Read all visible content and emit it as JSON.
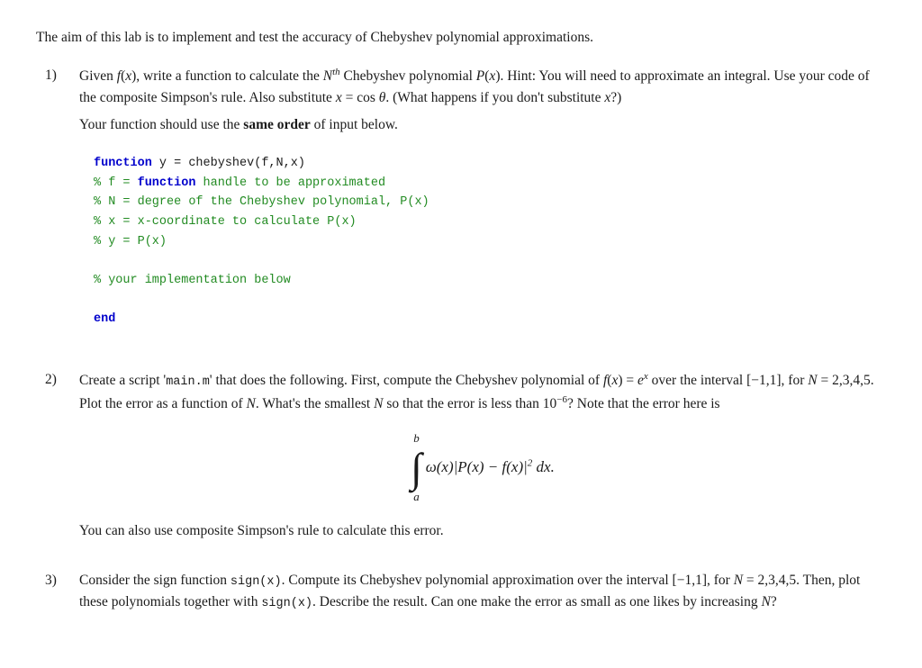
{
  "intro": "The aim of this lab is to implement and test the accuracy of Chebyshev polynomial approximations.",
  "questions": [
    {
      "number": "1)",
      "paragraphs": [
        "Given f(x), write a function to calculate the Nth Chebyshev polynomial P(x). Hint: You will need to approximate an integral. Use your code of the composite Simpson's rule. Also substitute x = cos θ. (What happens if you don't substitute x?)",
        "Your function should use the same order of input below."
      ],
      "code_lines": [
        {
          "parts": [
            {
              "text": "function",
              "style": "blue"
            },
            {
              "text": " y = chebyshev(f,N,x)",
              "style": "black"
            }
          ]
        },
        {
          "parts": [
            {
              "text": "% f = ",
              "style": "green"
            },
            {
              "text": "function",
              "style": "blue"
            },
            {
              "text": " handle ",
              "style": "green"
            },
            {
              "text": "to",
              "style": "green"
            },
            {
              "text": " be approximated",
              "style": "green"
            }
          ]
        },
        {
          "parts": [
            {
              "text": "% N = degree of the Chebyshev polynomial, P(x)",
              "style": "green"
            }
          ]
        },
        {
          "parts": [
            {
              "text": "% x = x-coordinate ",
              "style": "green"
            },
            {
              "text": "to",
              "style": "green"
            },
            {
              "text": " calculate P(x)",
              "style": "green"
            }
          ]
        },
        {
          "parts": [
            {
              "text": "% y = P(x)",
              "style": "green"
            }
          ]
        },
        {
          "parts": []
        },
        {
          "parts": [
            {
              "text": "% your implementation below",
              "style": "green"
            }
          ]
        },
        {
          "parts": []
        },
        {
          "parts": [
            {
              "text": "end",
              "style": "blue"
            }
          ]
        }
      ]
    },
    {
      "number": "2)",
      "paragraphs_before": [
        "Create a script 'main.m' that does the following. First, compute the Chebyshev polynomial of f(x) = eˣ over the interval [−1,1], for N = 2,3,4,5. Plot the error as a function of N. What's the smallest N so that the error is less than 10⁻⁶? Note that the error here is"
      ],
      "integral_display": true,
      "paragraphs_after": [
        "You can also use composite Simpson's rule to calculate this error."
      ]
    },
    {
      "number": "3)",
      "paragraphs": [
        "Consider the sign function sign(x). Compute its Chebyshev polynomial approximation over the interval [−1,1], for N = 2,3,4,5. Then, plot these polynomials together with sign(x). Describe the result. Can one make the error as small as one likes by increasing N?"
      ]
    }
  ],
  "labels": {
    "same_order": "same order",
    "integral_a": "a",
    "integral_b": "b",
    "integral_expr": "ω(x)|P(x) − f(x)|² dx."
  }
}
